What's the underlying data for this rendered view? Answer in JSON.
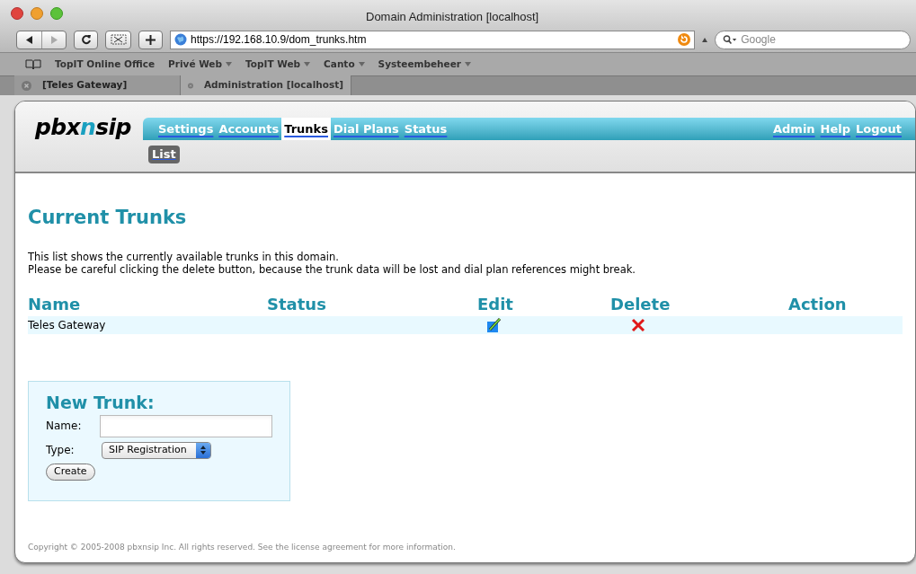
{
  "window": {
    "title": "Domain Administration [localhost]"
  },
  "toolbar": {
    "url": "https://192.168.10.9/dom_trunks.htm",
    "search_placeholder": "Google"
  },
  "bookmarks": [
    {
      "label": "TopIT Online Office",
      "menu": false
    },
    {
      "label": "Privé Web",
      "menu": true
    },
    {
      "label": "TopIT Web",
      "menu": true
    },
    {
      "label": "Canto",
      "menu": true
    },
    {
      "label": "Systeembeheer",
      "menu": true
    }
  ],
  "browser_tabs": [
    {
      "label": "[Teles Gateway]",
      "selected": false
    },
    {
      "label": "Administration [localhost]",
      "selected": true
    }
  ],
  "logo": {
    "parts": [
      {
        "text": "pbx",
        "accent": false
      },
      {
        "text": "n",
        "accent": true
      },
      {
        "text": "sip",
        "accent": false
      }
    ]
  },
  "nav": [
    {
      "label": "Settings",
      "selected": false
    },
    {
      "label": "Accounts",
      "selected": false
    },
    {
      "label": "Trunks",
      "selected": true
    },
    {
      "label": "Dial Plans",
      "selected": false
    },
    {
      "label": "Status",
      "selected": false
    }
  ],
  "nav_right": [
    "Admin",
    "Help",
    "Logout"
  ],
  "subnav": [
    {
      "label": "List",
      "selected": true
    }
  ],
  "heading": "Current Trunks",
  "intro": [
    "This list shows the currently available trunks in this domain.",
    "Please be careful clicking the delete button, because the trunk data will be lost and dial plan references might break."
  ],
  "table": {
    "columns": [
      "Name",
      "Status",
      "Edit",
      "Delete",
      "Action"
    ],
    "rows": [
      {
        "name": "Teles Gateway",
        "status": "",
        "editable": true,
        "deletable": true
      }
    ]
  },
  "new_trunk": {
    "title": "New Trunk:",
    "name_label": "Name:",
    "type_label": "Type:",
    "type_value": "SIP Registration",
    "button": "Create"
  },
  "footer": "Copyright © 2005-2008 pbxnsip Inc. All rights reserved. See the license agreement for more information."
}
